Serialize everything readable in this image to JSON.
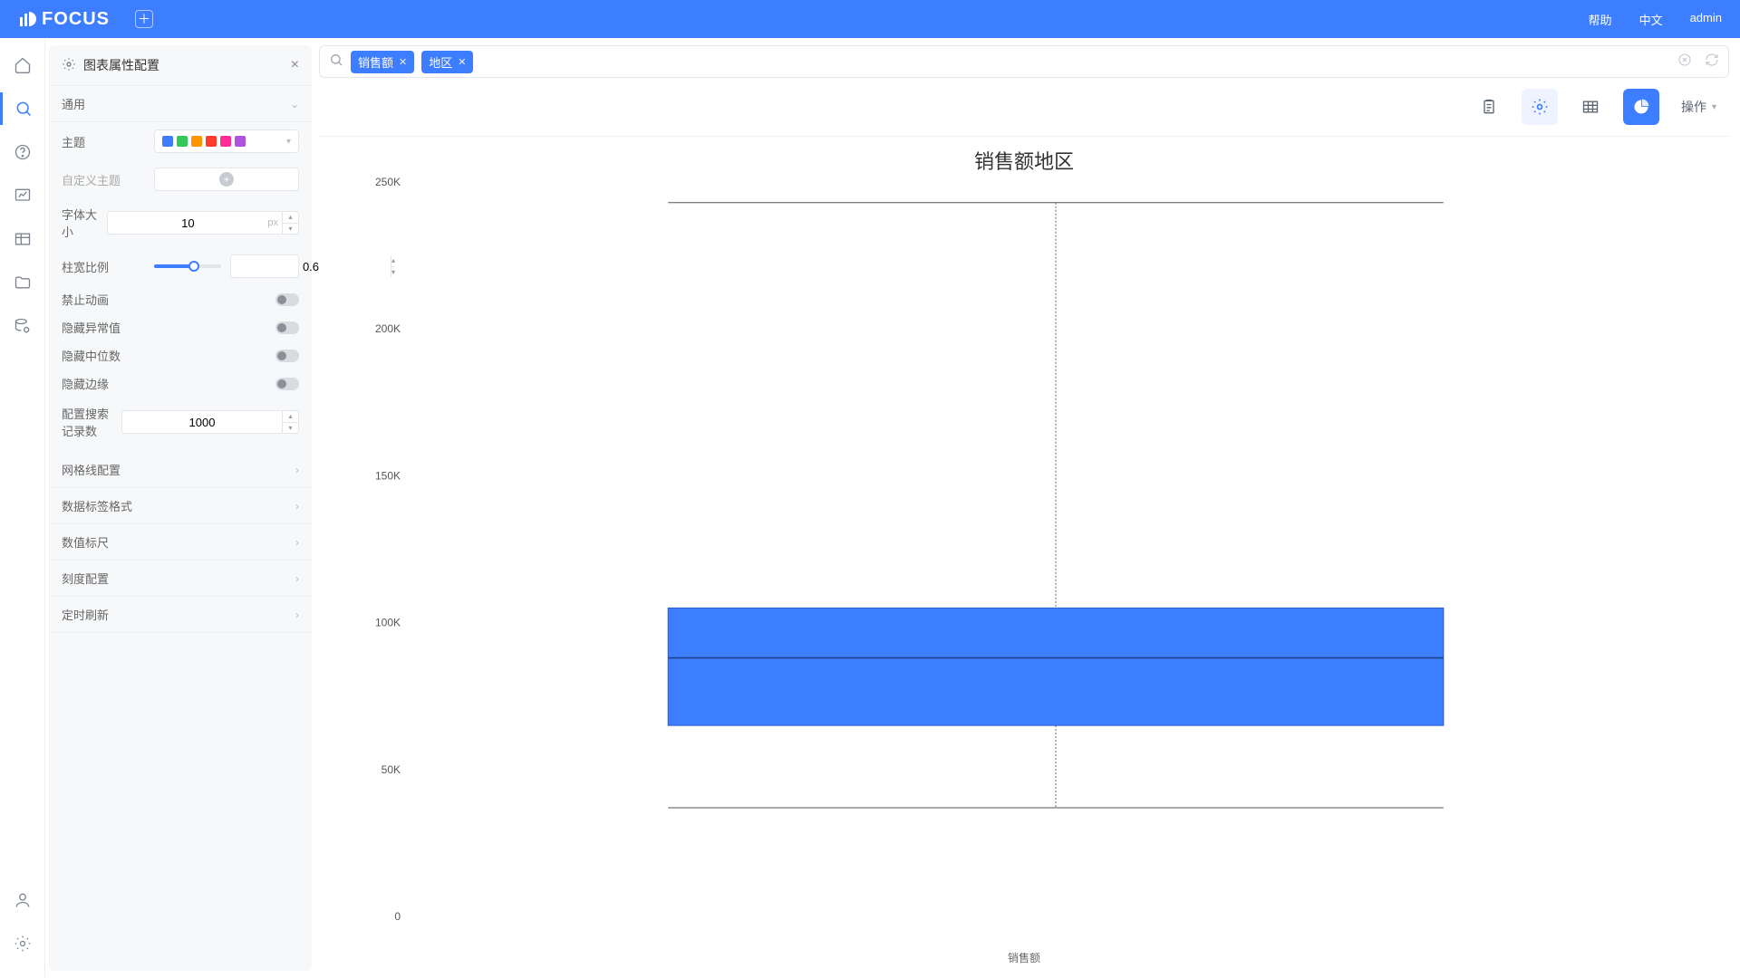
{
  "brand": "FOCUS",
  "top_nav": {
    "help": "帮助",
    "lang": "中文",
    "user": "admin"
  },
  "rail": {
    "items": [
      "home",
      "search",
      "help",
      "trend",
      "table",
      "folder",
      "db-gear"
    ],
    "bottom": [
      "user",
      "gear"
    ],
    "active": "search"
  },
  "panel": {
    "title": "图表属性配置",
    "sections": {
      "general": "通用",
      "gridline": "网格线配置",
      "dataLabelFmt": "数据标签格式",
      "valueRuler": "数值标尺",
      "tickCfg": "刻度配置",
      "timedRefresh": "定时刷新"
    },
    "props": {
      "theme_label": "主题",
      "theme_colors": [
        "#3d7dff",
        "#34c759",
        "#ff9500",
        "#ff3b30",
        "#ff2d95",
        "#af52de"
      ],
      "custom_theme_label": "自定义主题",
      "font_size_label": "字体大小",
      "font_size_value": "10",
      "font_size_unit": "px",
      "bar_ratio_label": "柱宽比例",
      "bar_ratio_value": "0.6",
      "toggles": {
        "disable_anim": "禁止动画",
        "hide_outlier": "隐藏异常值",
        "hide_median": "隐藏中位数",
        "hide_edge": "隐藏边缘"
      },
      "search_rec_label": "配置搜索记录数",
      "search_rec_value": "1000"
    }
  },
  "search": {
    "chips": [
      "销售额",
      "地区"
    ]
  },
  "toolbar": {
    "ops_label": "操作"
  },
  "chart_data": {
    "type": "boxplot",
    "title": "销售额地区",
    "xlabel": "销售额",
    "ylabel": "",
    "ylim": [
      0,
      250000
    ],
    "yticks": [
      0,
      50000,
      100000,
      150000,
      200000,
      250000
    ],
    "ytick_labels": [
      "0",
      "50K",
      "100K",
      "150K",
      "200K",
      "250K"
    ],
    "categories": [
      "销售额"
    ],
    "series": [
      {
        "name": "销售额",
        "q1": 65000,
        "median": 88000,
        "q3": 105000,
        "whisker_low": 37000,
        "whisker_high": 243000
      }
    ],
    "color": "#3d7dff"
  }
}
